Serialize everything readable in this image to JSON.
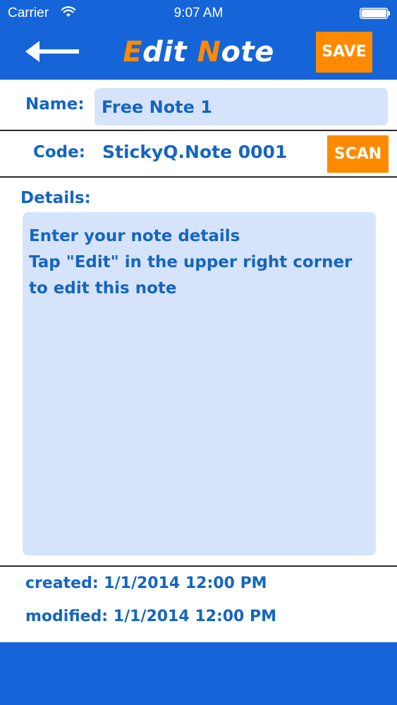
{
  "status_bar": {
    "carrier": "Carrier",
    "time": "9:07 AM",
    "wifi_icon": "wifi-icon",
    "battery_icon": "battery-icon"
  },
  "header": {
    "title_part1_accent": "E",
    "title_part1_rest": "dit ",
    "title_part2_accent": "N",
    "title_part2_rest": "ote",
    "back_icon": "back-arrow-icon",
    "save_label": "SAVE"
  },
  "form": {
    "name_label": "Name:",
    "name_value": "Free Note 1",
    "code_label": "Code:",
    "code_value": "StickyQ.Note 0001",
    "scan_label": "SCAN",
    "details_label": "Details:",
    "details_value": "Enter your note details\nTap \"Edit\" in the upper right corner\nto edit this note"
  },
  "footer": {
    "created": "created: 1/1/2014 12:00 PM",
    "modified": "modified: 1/1/2014 12:00 PM"
  },
  "colors": {
    "brand_blue": "#1565d8",
    "accent_orange": "#ff8a00",
    "text_blue": "#1565c0",
    "field_bg": "#d6e4fb"
  }
}
